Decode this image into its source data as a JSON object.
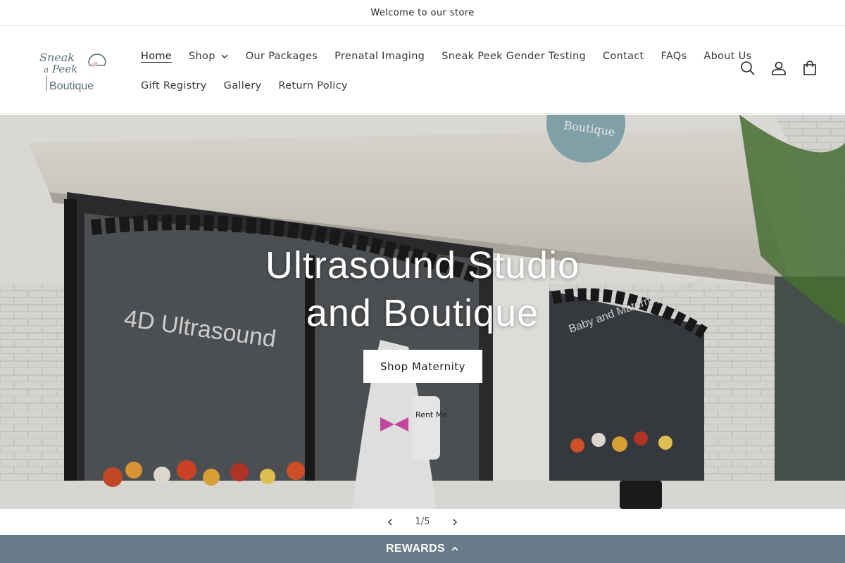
{
  "announcement": {
    "text": "Welcome to our store"
  },
  "brand": {
    "logo_lines": [
      "Sneak",
      "a",
      "Peek",
      "Boutique"
    ],
    "accent": "#5b6e78",
    "heart": "#f2c5c9"
  },
  "nav": {
    "row1": [
      {
        "label": "Home",
        "active": true
      },
      {
        "label": "Shop",
        "has_dropdown": true
      },
      {
        "label": "Our Packages"
      },
      {
        "label": "Prenatal Imaging"
      },
      {
        "label": "Sneak Peek Gender Testing"
      },
      {
        "label": "Contact"
      },
      {
        "label": "FAQs"
      },
      {
        "label": "About Us"
      }
    ],
    "row2": [
      {
        "label": "Gift Registry"
      },
      {
        "label": "Gallery"
      },
      {
        "label": "Return Policy"
      }
    ]
  },
  "icons": {
    "search": "search-icon",
    "account": "account-icon",
    "cart": "cart-icon"
  },
  "hero": {
    "title_line1": "Ultrasound Studio",
    "title_line2": "and Boutique",
    "button_label": "Shop Maternity",
    "window_text": "4D Ultrasound",
    "window_text_right": "Baby and Maternity Boutique",
    "sign_text": "Boutique",
    "stork_text": "Rent Me"
  },
  "slider": {
    "counter": "1/5"
  },
  "rewards": {
    "label": "REWARDS",
    "bg": "#667b87"
  }
}
